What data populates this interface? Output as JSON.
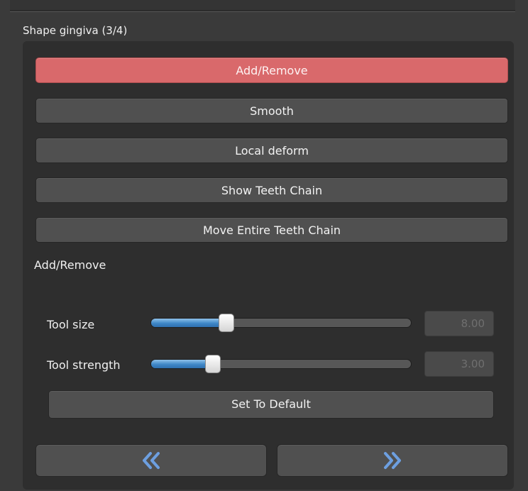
{
  "section": {
    "title": "Shape gingiva (3/4)"
  },
  "tools": [
    {
      "label": "Add/Remove",
      "active": true
    },
    {
      "label": "Smooth",
      "active": false
    },
    {
      "label": "Local deform",
      "active": false
    },
    {
      "label": "Show Teeth Chain",
      "active": false
    },
    {
      "label": "Move Entire Teeth Chain",
      "active": false
    }
  ],
  "current_tool": {
    "title": "Add/Remove"
  },
  "sliders": {
    "tool_size": {
      "label": "Tool size",
      "value": "8.00",
      "fraction": 0.29
    },
    "tool_strength": {
      "label": "Tool strength",
      "value": "3.00",
      "fraction": 0.24
    }
  },
  "set_default": {
    "label": "Set To Default"
  },
  "nav": {
    "prev_icon": "double-chevron-left-icon",
    "next_icon": "double-chevron-right-icon"
  },
  "colors": {
    "active_button": "#d9696b",
    "slider_fill": "#3f87c7",
    "nav_arrow": "#6d9fe0",
    "panel_bg": "#2e2e2e"
  }
}
